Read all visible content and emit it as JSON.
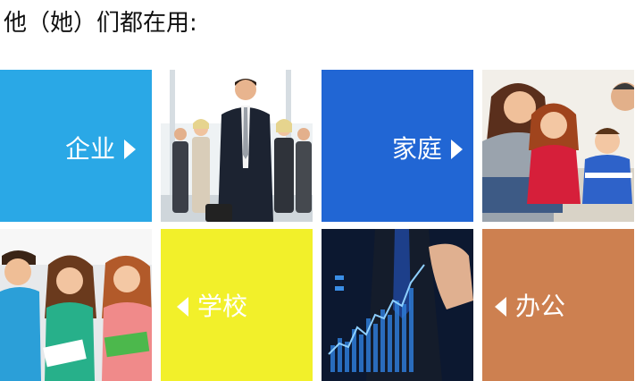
{
  "heading": "他（她）们都在用:",
  "tiles": {
    "enterprise": {
      "label": "企业",
      "color": "#2aa8e6"
    },
    "family": {
      "label": "家庭",
      "color": "#2166d4"
    },
    "school": {
      "label": "学校",
      "color": "#f2f02a"
    },
    "office": {
      "label": "办公",
      "color": "#cd8050"
    }
  }
}
